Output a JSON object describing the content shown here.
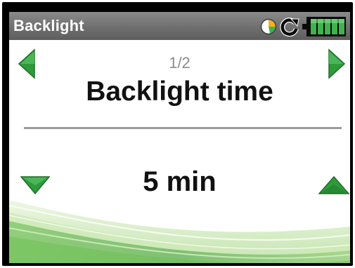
{
  "header": {
    "title": "Backlight",
    "icons": [
      "pie-clock-icon",
      "refresh-icon",
      "battery-icon"
    ]
  },
  "pager": {
    "indicator": "1/2"
  },
  "setting": {
    "title": "Backlight time",
    "value": "5 min"
  },
  "colors": {
    "header_bg": "#6f6f6f",
    "arrow_green": "#2e9b3a",
    "battery_green": "#3fb34f",
    "divider": "#9b9b9b"
  }
}
